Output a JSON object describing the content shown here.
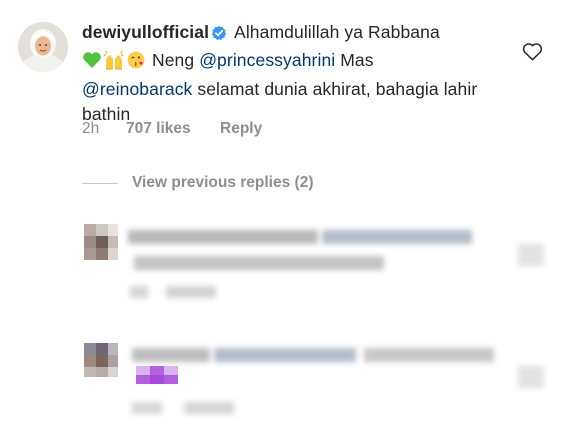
{
  "comment": {
    "username": "dewiyullofficial",
    "verified_icon": "verified-badge-icon",
    "text_1": "Alhamdulillah ya Rabbana",
    "emoji_1": "green-heart-emoji",
    "emoji_2": "raised-hands-emoji",
    "emoji_3": "face-blowing-kiss-emoji",
    "text_2": "Neng",
    "mention_1": "@princessyahrini",
    "text_3": "Mas",
    "mention_2": "@reinobarack",
    "text_4": "selamat dunia akhirat, bahagia lahir bathin",
    "time": "2h",
    "likes": "707 likes",
    "reply_label": "Reply",
    "like_icon": "heart-outline-icon"
  },
  "replies": {
    "view_previous_label": "View previous replies (2)"
  },
  "colors": {
    "text": "#262626",
    "mention": "#00376b",
    "secondary": "#8e8e8e",
    "verified": "#3897f0",
    "censor_purple": "#b45fe0"
  }
}
